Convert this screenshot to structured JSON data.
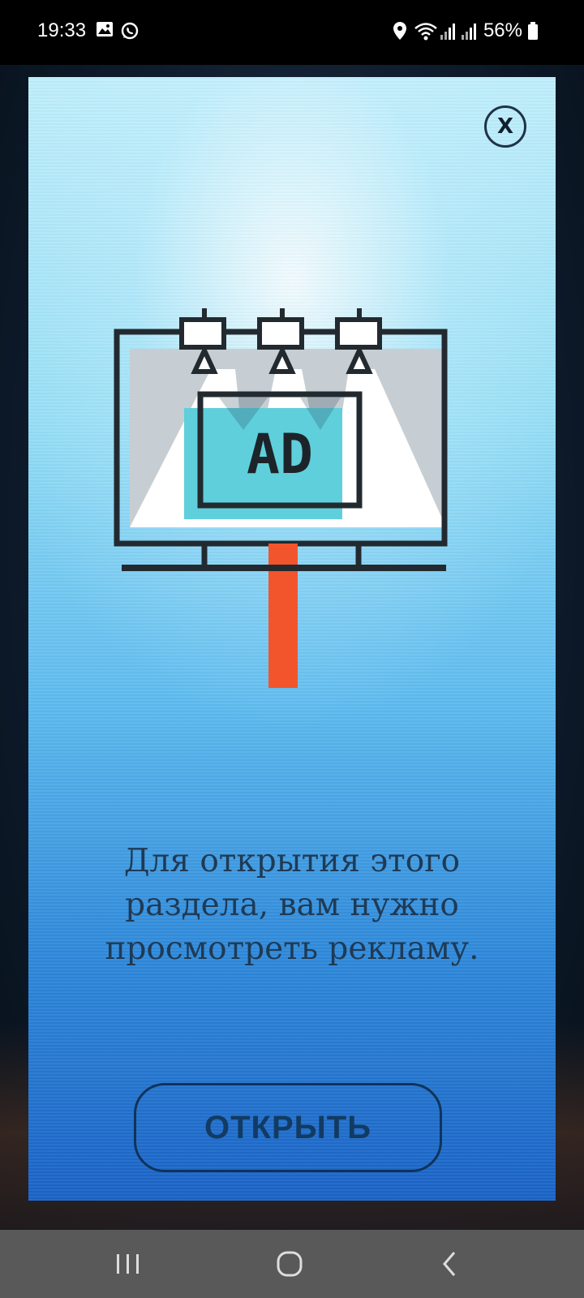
{
  "status_bar": {
    "time": "19:33",
    "battery": "56%",
    "icons": [
      "gallery-icon",
      "whatsapp-icon",
      "location-icon",
      "wifi-icon",
      "signal-icon",
      "signal-icon",
      "battery-icon"
    ]
  },
  "dialog": {
    "close_label": "X",
    "ad_label": "AD",
    "message_lines": [
      "Для открытия этого",
      "раздела, вам нужно",
      "просмотреть рекламу."
    ],
    "open_button_label": "ОТКРЫТЬ"
  },
  "colors": {
    "accent_red": "#f2552c",
    "ad_cyan": "#5fcfdb",
    "dark_stroke": "#222a30"
  },
  "nav_bar": {
    "buttons": [
      "recents-icon",
      "home-icon",
      "back-icon"
    ]
  }
}
